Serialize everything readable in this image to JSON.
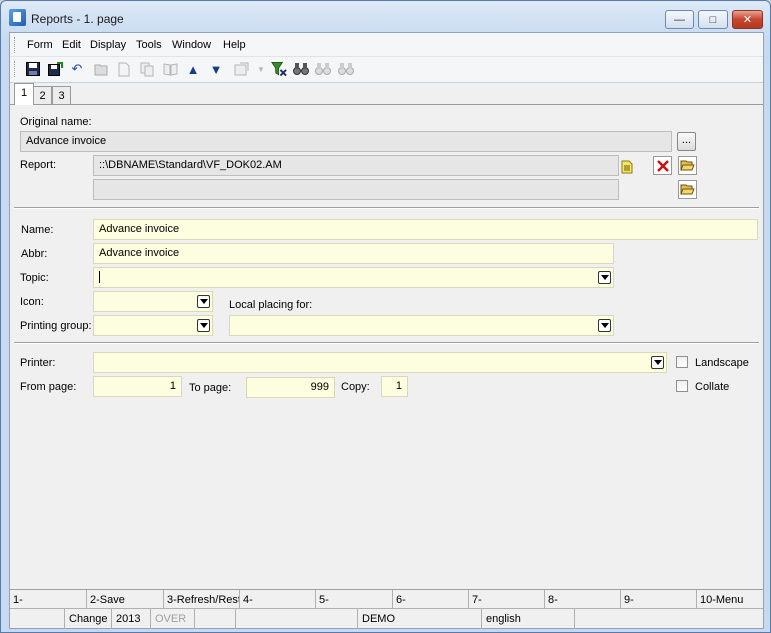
{
  "window": {
    "title": "Reports - 1. page",
    "minimize_glyph": "—",
    "maximize_glyph": "□",
    "close_glyph": "✕"
  },
  "menu": [
    "Form",
    "Edit",
    "Display",
    "Tools",
    "Window",
    "Help"
  ],
  "toolbar": {
    "icons": [
      "save-icon",
      "save-as-icon",
      "undo-icon",
      "open-folder-icon",
      "new-document-icon",
      "copy-icon",
      "book-icon",
      "arrow-up-icon",
      "arrow-down-icon",
      "properties-icon",
      "dropdown-arrow-icon",
      "filter-icon",
      "binoculars-icon",
      "find-next-icon",
      "find-previous-icon"
    ]
  },
  "tabs": [
    "1",
    "2",
    "3"
  ],
  "form": {
    "original_name_label": "Original name:",
    "original_name_value": "Advance invoice",
    "browse_button": "...",
    "report_label": "Report:",
    "report_path": "::\\DBNAME\\Standard\\VF_DOK02.AM",
    "report_path2": "",
    "name_label": "Name:",
    "name_value": "Advance invoice",
    "abbr_label": "Abbr:",
    "abbr_value": "Advance invoice",
    "topic_label": "Topic:",
    "topic_value": "",
    "icon_label": "Icon:",
    "icon_value": "",
    "local_placing_label": "Local placing for:",
    "local_placing_value": "",
    "printing_group_label": "Printing group:",
    "printing_group_value": "",
    "printer_label": "Printer:",
    "printer_value": "",
    "landscape_label": "Landscape",
    "landscape_checked": false,
    "collate_label": "Collate",
    "collate_checked": false,
    "from_page_label": "From page:",
    "from_page_value": "1",
    "to_page_label": "To page:",
    "to_page_value": "999",
    "copy_label": "Copy:",
    "copy_value": "1"
  },
  "function_keys": [
    "1-",
    "2-Save",
    "3-Refresh/Rest",
    "4-",
    "5-",
    "6-",
    "7-",
    "8-",
    "9-",
    "10-Menu"
  ],
  "status": {
    "cell0": "",
    "mode": "Change",
    "year": "2013",
    "over": "OVER",
    "cell4": "",
    "cell5": "",
    "database": "DEMO",
    "language": "english",
    "cell8": ""
  },
  "colors": {
    "field_yellow": "#fdfddf",
    "field_gray": "#e6e6e6",
    "close_red": "#c7452d"
  }
}
